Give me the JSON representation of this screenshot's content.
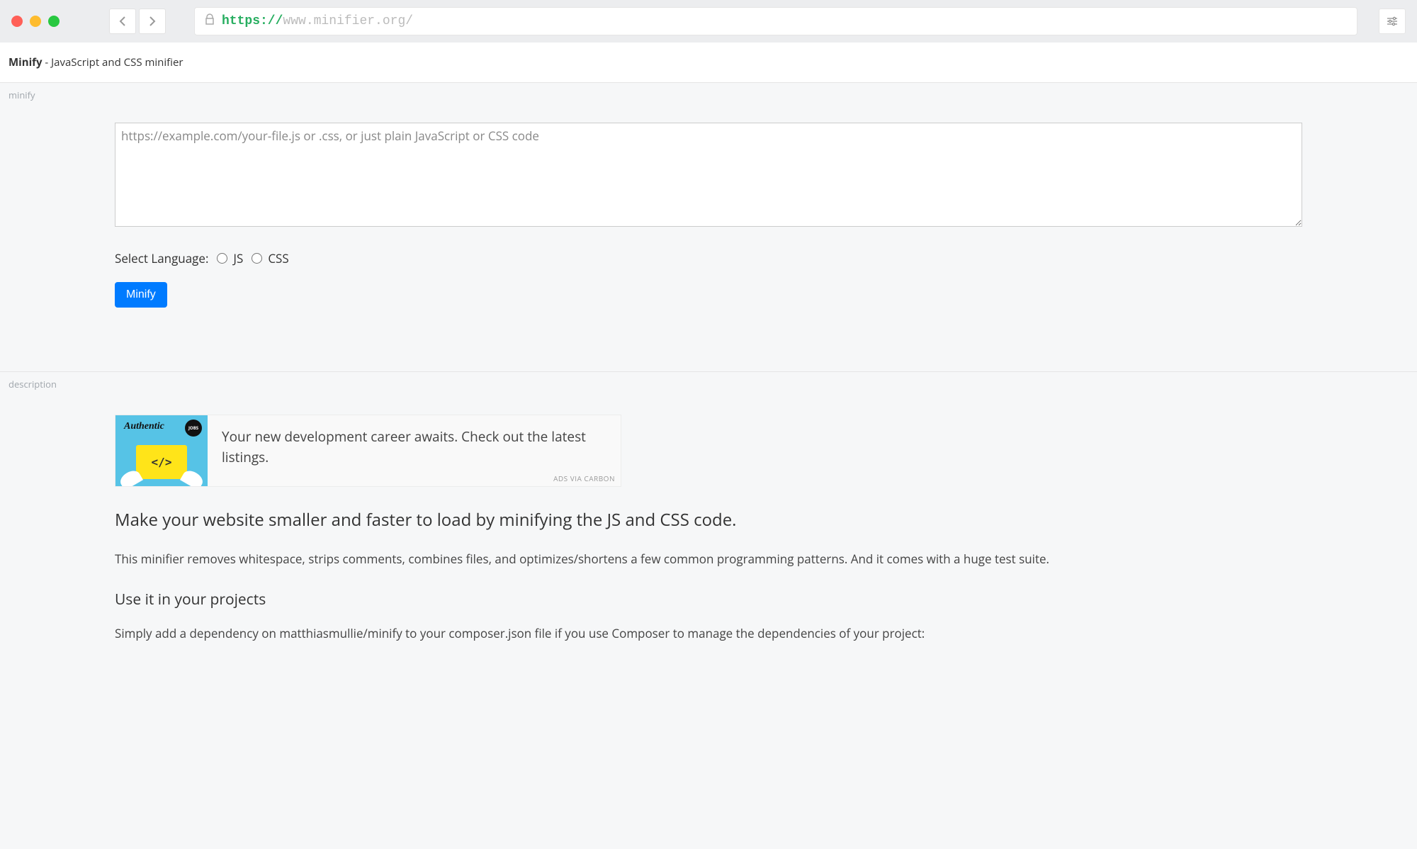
{
  "browser": {
    "url_scheme": "https://",
    "url_rest": "www.minifier.org/"
  },
  "header": {
    "site_name": "Minify",
    "tagline": " - JavaScript and CSS minifier"
  },
  "sections": {
    "minify_label": "minify",
    "description_label": "description"
  },
  "form": {
    "textarea_placeholder": "https://example.com/your-file.js or .css, or just plain JavaScript or CSS code",
    "select_language_label": "Select Language:",
    "lang_js": "JS",
    "lang_css": "CSS",
    "minify_button": "Minify"
  },
  "ad": {
    "logo_text": "Authentic",
    "badge_text": "JOBS",
    "code_glyph": "</>",
    "text": "Your new development career awaits. Check out the latest listings.",
    "via": "ADS VIA CARBON"
  },
  "description": {
    "headline": "Make your website smaller and faster to load by minifying the JS and CSS code.",
    "paragraph1": "This minifier removes whitespace, strips comments, combines files, and optimizes/shortens a few common programming patterns. And it comes with a huge test suite.",
    "subheading": "Use it in your projects",
    "paragraph2": "Simply add a dependency on matthiasmullie/minify to your composer.json file if you use Composer to manage the dependencies of your project:"
  }
}
